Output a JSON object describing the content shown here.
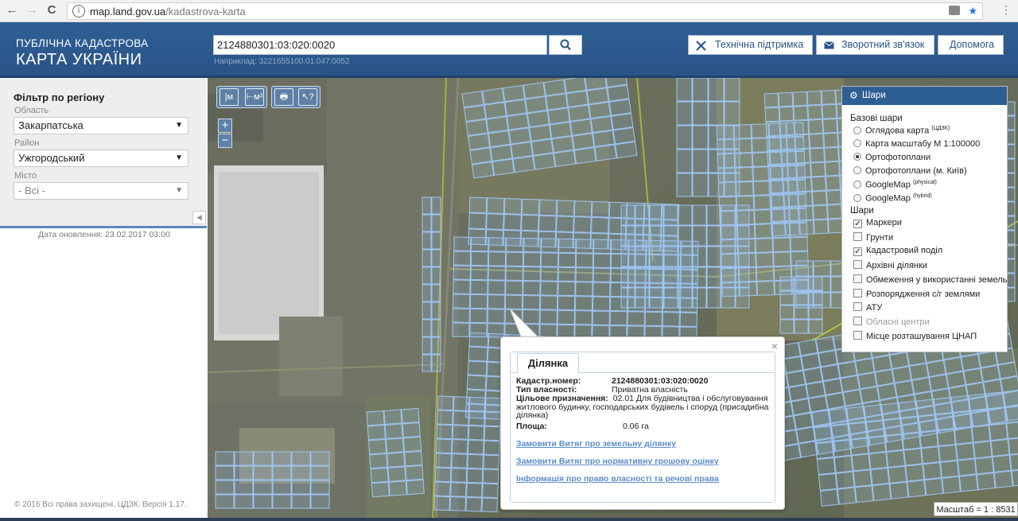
{
  "browser": {
    "back": "←",
    "forward": "→",
    "reload": "C",
    "info": "i",
    "url_host": "map.land.gov.ua",
    "url_path": "/kadastrova-karta",
    "star": "★",
    "menu": "⋮"
  },
  "header": {
    "logo_line1": "ПУБЛІЧНА КАДАСТРОВА",
    "logo_line2": "КАРТА УКРАЇНИ",
    "search_value": "2124880301:03:020:0020",
    "search_example": "Наприклад: 3221655100:01:047:0052",
    "support_label": "Технічна підтримка",
    "feedback_label": "Зворотний зв'язок",
    "help_label": "Допомога"
  },
  "filter": {
    "title": "Фільтр по регіону",
    "oblast_label": "Область",
    "oblast_value": "Закарпатська",
    "raion_label": "Район",
    "raion_value": "Ужгородський",
    "city_label": "Місто",
    "city_value": "- Всі -",
    "arrow": "▼",
    "collapse": "◀",
    "update": "Дата оновлення: 23.02.2017 03:00",
    "copyright": "© 2016 Всі права захищені. ЦДЗК. Версія 1.17."
  },
  "tools": {
    "t1": "|м",
    "t2": "⊢м²",
    "t3": "🖶",
    "t4": "↖?",
    "zoom_in": "+",
    "zoom_out": "−"
  },
  "layers": {
    "title": "Шари",
    "base_title": "Базові шари",
    "base": [
      {
        "label": "Оглядова карта",
        "sup": "(ЦДЗК)",
        "on": false
      },
      {
        "label": "Карта масштабу М 1:100000",
        "sup": "",
        "on": false
      },
      {
        "label": "Ортофотоплани",
        "sup": "",
        "on": true
      },
      {
        "label": "Ортофотоплани (м. Київ)",
        "sup": "",
        "on": false
      },
      {
        "label": "GoogleMap",
        "sup": "(physical)",
        "on": false
      },
      {
        "label": "GoogleMap",
        "sup": "(hybrid)",
        "on": false
      }
    ],
    "overlay_title": "Шари",
    "overlays": [
      {
        "label": "Маркери",
        "on": true,
        "dim": false
      },
      {
        "label": "Грунти",
        "on": false,
        "dim": false
      },
      {
        "label": "Кадастровий поділ",
        "on": true,
        "dim": false
      },
      {
        "label": "Архівні ділянки",
        "on": false,
        "dim": false
      },
      {
        "label": "Обмеження у використанні земель",
        "on": false,
        "dim": false
      },
      {
        "label": "Розпорядження с/г землями",
        "on": false,
        "dim": false
      },
      {
        "label": "АТУ",
        "on": false,
        "dim": false
      },
      {
        "label": "Обласні центри",
        "on": false,
        "dim": true
      },
      {
        "label": "Місце розташування ЦНАП",
        "on": false,
        "dim": false
      }
    ]
  },
  "popup": {
    "close": "×",
    "tab": "Ділянка",
    "cad_label": "Кадастр.номер:",
    "cad_value": "2124880301:03:020:0020",
    "own_label": "Тип власності:",
    "own_value": "Приватна власність",
    "purpose_label": "Цільове призначення:",
    "purpose_value": "02.01 Для будівництва і обслуговування житлового будинку, господарських будівель і споруд (присадибна ділянка)",
    "area_label": "Площа:",
    "area_value": "0.06 га",
    "link1": "Замовити Витяг про земельну ділянку",
    "link2": "Замовити Витяг про нормативну грошову оцінку",
    "link3": "Інформація про право власності та речові права"
  },
  "scale": "Масштаб = 1 : 8531"
}
